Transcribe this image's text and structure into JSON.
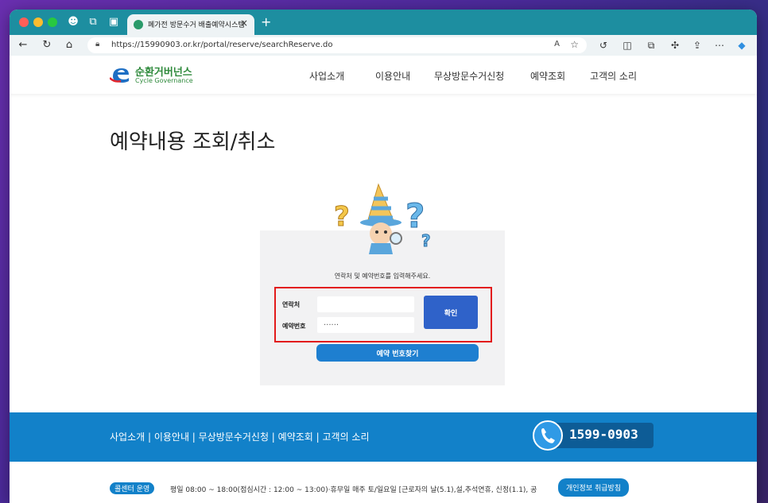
{
  "browser": {
    "tab_title": "폐가전 방문수거 배출예약시스템",
    "new_tab": "+",
    "tab_close": "×",
    "url": "https://15990903.or.kr/portal/reserve/searchReserve.do",
    "read_aloud": "A",
    "icons": [
      "back-icon",
      "refresh-icon",
      "home-icon",
      "lock-icon",
      "star-icon",
      "split-icon",
      "collections-icon",
      "extensions-icon",
      "share-icon",
      "more-icon",
      "copilot-icon"
    ]
  },
  "site": {
    "logo_name": "순환거버넌스",
    "logo_sub": "Cycle Governance",
    "nav": [
      "사업소개",
      "이용안내",
      "무상방문수거신청",
      "예약조회",
      "고객의 소리"
    ]
  },
  "main": {
    "title": "예약내용 조회/취소",
    "instruction": "연락처 및 예약번호를 입력해주세요.",
    "phone_label": "연락처",
    "phone_value": "",
    "reservation_label": "예약번호",
    "reservation_value": "······",
    "confirm_button": "확인",
    "find_button": "예약 번호찾기"
  },
  "footer": {
    "nav": "사업소개  |  이용안내  |  무상방문수거신청  |  예약조회  |  고객의 소리",
    "phone": "1599-0903",
    "callcenter_badge": "콜센터 운영",
    "hours": "평일 08:00 ~ 18:00(점심시간 : 12:00 ~ 13:00)·휴무일 매주 토/일요일  [근로자의 날(5.1),설,추석연휴, 신정(1.1), 공",
    "privacy": "개인정보 취급방침"
  },
  "colors": {
    "tabbar": "#1d8ea0",
    "footer": "#1281c9",
    "confirm": "#2f62c9",
    "highlight": "#e21b1b",
    "logo": "#2f8a3c"
  }
}
